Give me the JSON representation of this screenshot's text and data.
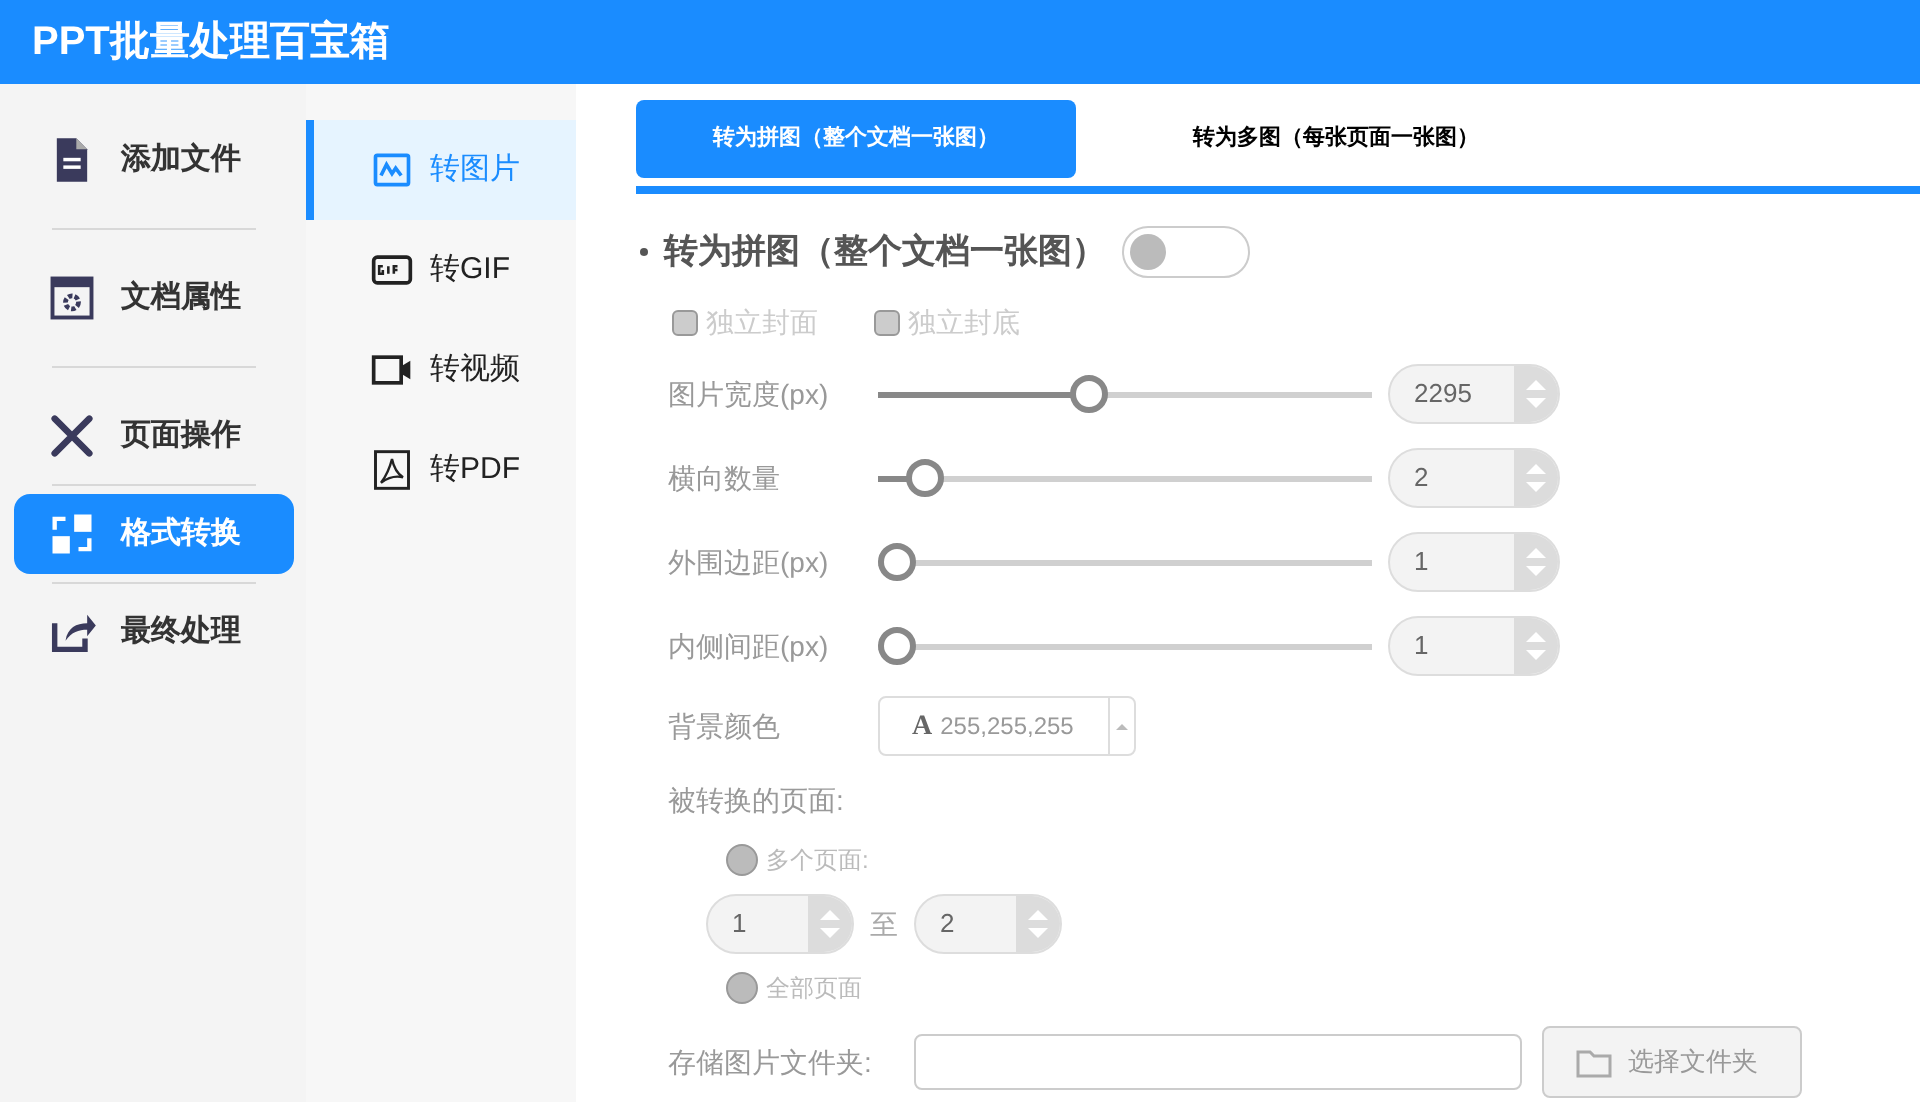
{
  "app": {
    "title": "PPT批量处理百宝箱"
  },
  "sidebar": {
    "items": [
      {
        "label": "添加文件",
        "selected": false
      },
      {
        "label": "文档属性",
        "selected": false
      },
      {
        "label": "页面操作",
        "selected": false
      },
      {
        "label": "格式转换",
        "selected": true
      },
      {
        "label": "最终处理",
        "selected": false
      }
    ]
  },
  "subnav": {
    "items": [
      {
        "label": "转图片",
        "selected": true
      },
      {
        "label": "转GIF",
        "selected": false
      },
      {
        "label": "转视频",
        "selected": false
      },
      {
        "label": "转PDF",
        "selected": false
      }
    ]
  },
  "tabs": [
    {
      "label": "转为拼图（整个文档一张图）",
      "selected": true
    },
    {
      "label": "转为多图（每张页面一张图）",
      "selected": false
    }
  ],
  "section": {
    "title": "转为拼图（整个文档一张图）",
    "on": false
  },
  "checkboxes": [
    {
      "label": "独立封面",
      "checked": false
    },
    {
      "label": "独立封底",
      "checked": false
    }
  ],
  "sliders": [
    {
      "label": "图片宽度(px)",
      "level": 0.42,
      "value": "2295"
    },
    {
      "label": "横向数量",
      "level": 0.06,
      "value": "2"
    },
    {
      "label": "外围边距(px)",
      "level": 0,
      "value": "1"
    },
    {
      "label": "内侧间距(px)",
      "level": 0,
      "value": "1"
    }
  ],
  "background_color": {
    "label": "背景颜色",
    "glyph": "A",
    "value": "255,255,255"
  },
  "pages": {
    "label": "被转换的页面:",
    "options": [
      {
        "label": "多个页面:",
        "selected": false
      },
      {
        "label": "全部页面",
        "selected": false
      }
    ],
    "from": "1",
    "separator": "至",
    "to": "2"
  },
  "folder": {
    "label": "存储图片文件夹:",
    "button": "选择文件夹"
  }
}
